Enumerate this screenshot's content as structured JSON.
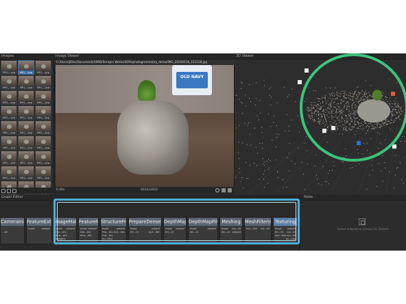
{
  "images": {
    "title": "Images",
    "thumbnails": [
      {
        "caption": "IMG_...jpg",
        "selected": false
      },
      {
        "caption": "IMG_...jpg",
        "selected": true
      },
      {
        "caption": "IMG_...jpg",
        "selected": false
      },
      {
        "caption": "IMG_...jpg",
        "selected": false
      },
      {
        "caption": "IMG_...jpg",
        "selected": false
      },
      {
        "caption": "IMG_...jpg",
        "selected": false
      },
      {
        "caption": "IMG_...jpg",
        "selected": false
      },
      {
        "caption": "IMG_...jpg",
        "selected": false
      },
      {
        "caption": "IMG_...jpg",
        "selected": false
      },
      {
        "caption": "IMG_...jpg",
        "selected": false
      },
      {
        "caption": "IMG_...jpg",
        "selected": false
      },
      {
        "caption": "IMG_...jpg",
        "selected": false
      },
      {
        "caption": "IMG_...jpg",
        "selected": false
      },
      {
        "caption": "IMG_...jpg",
        "selected": false
      },
      {
        "caption": "IMG_...jpg",
        "selected": false
      },
      {
        "caption": "IMG_...jpg",
        "selected": false
      },
      {
        "caption": "IMG_...jpg",
        "selected": false
      },
      {
        "caption": "IMG_...jpg",
        "selected": false
      },
      {
        "caption": "IMG_...jpg",
        "selected": false
      },
      {
        "caption": "IMG_...jpg",
        "selected": false
      },
      {
        "caption": "IMG_...jpg",
        "selected": false
      },
      {
        "caption": "IMG_...jpg",
        "selected": false
      },
      {
        "caption": "IMG_...jpg",
        "selected": false
      },
      {
        "caption": "IMG_...jpg",
        "selected": false
      },
      {
        "caption": "IMG_...jpg",
        "selected": false
      },
      {
        "caption": "IMG_...jpg",
        "selected": false
      },
      {
        "caption": "IMG_...jpg",
        "selected": false
      }
    ]
  },
  "image_viewer": {
    "title": "Image Viewer",
    "path": "C:/Users/jlDes/Documents/UMD/Terrapin Works/SOPs/photogrammetry_demo/IMG_20200518_151518.jpg",
    "bag_text": "OLD NAVY",
    "zoom": "0.40x",
    "resolution": "4032x3024"
  },
  "viewer_3d": {
    "title": "3D Viewer"
  },
  "graph_editor": {
    "title": "Graph Editor",
    "nodes": [
      {
        "title": "CameraInit",
        "in": "",
        "out": "",
        "in2": "...se",
        "out2": ""
      },
      {
        "title": "FeatureExtraction",
        "in": "input",
        "out": "output",
        "in2": "",
        "out2": ""
      },
      {
        "title": "ImageMatching",
        "in": "input",
        "out": "output",
        "in2": "fea...ers",
        "in3": "ima...ers",
        "in4": "weights"
      },
      {
        "title": "FeatureMatching",
        "in": "input",
        "out": "output",
        "in2": "fea...ers",
        "in3": "ima...list"
      },
      {
        "title": "StructureFromMotion",
        "in": "input",
        "out": "output",
        "in2": "fea...ers",
        "out2": "out...ses",
        "in3": "ma...ers",
        "in4": "ini...Pair"
      },
      {
        "title": "PrepareDenseScene",
        "in": "input",
        "out": "output",
        "in2": "im...rs",
        "out2": "out...der"
      },
      {
        "title": "DepthMap",
        "in": "input",
        "out": "output",
        "in2": "im...er"
      },
      {
        "title": "DepthMapFilter",
        "in": "input",
        "out": "output",
        "in2": "de...er"
      },
      {
        "title": "Meshing",
        "in": "input",
        "out": "ou...sh",
        "in2": "de...er",
        "out2": "output"
      },
      {
        "title": "MeshFiltering",
        "in": "inp...esh",
        "out": "ou...sh"
      },
      {
        "title": "Texturing",
        "in": "input",
        "out": "output",
        "in2": "im...er",
        "out2": "ou...sh",
        "in3": "inp...esh",
        "out3": "ou...ial",
        "out4": "ou...res"
      }
    ]
  },
  "node_panel": {
    "title": "Node",
    "hint": "Select a Node to access its Details"
  },
  "colors": {
    "highlight_circle": "#3cc47a",
    "highlight_box": "#4cb0d8",
    "selected_thumb": "#3f6ea8"
  }
}
